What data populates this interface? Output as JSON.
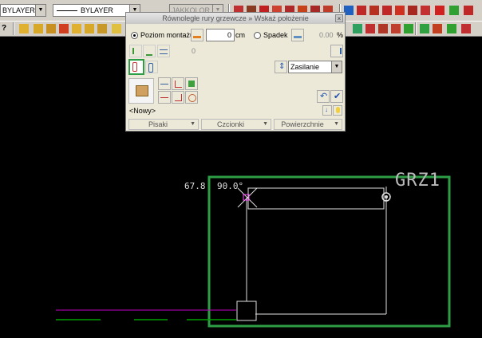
{
  "toolbar": {
    "layer_combo": "BYLAYER",
    "linetype_combo": "BYLAYER",
    "color_combo": "JAKKOLOR"
  },
  "dialog": {
    "title": "Równoległe rury grzewcze » Wskaż położenie",
    "close_glyph": "×",
    "mode_level_label": "Poziom montażu",
    "level_value": "0",
    "level_unit": "cm",
    "mode_slope_label": "Spadek",
    "slope_value": "0.00",
    "slope_unit": "%",
    "spacing_value": "0",
    "supply_select": "Zasilanie",
    "new_label": "<Nowy>",
    "tabs": [
      "Pisaki",
      "Czcionki",
      "Powierzchnie"
    ]
  },
  "canvas": {
    "dimension_text": "67.8",
    "angle_text": "90.0°",
    "room_label": "GRZ1"
  },
  "colors": {
    "highlight_green": "#2e9e46",
    "cad_white": "#e0e0e0",
    "magenta_line": "#c000c0",
    "green_line": "#00a000"
  }
}
